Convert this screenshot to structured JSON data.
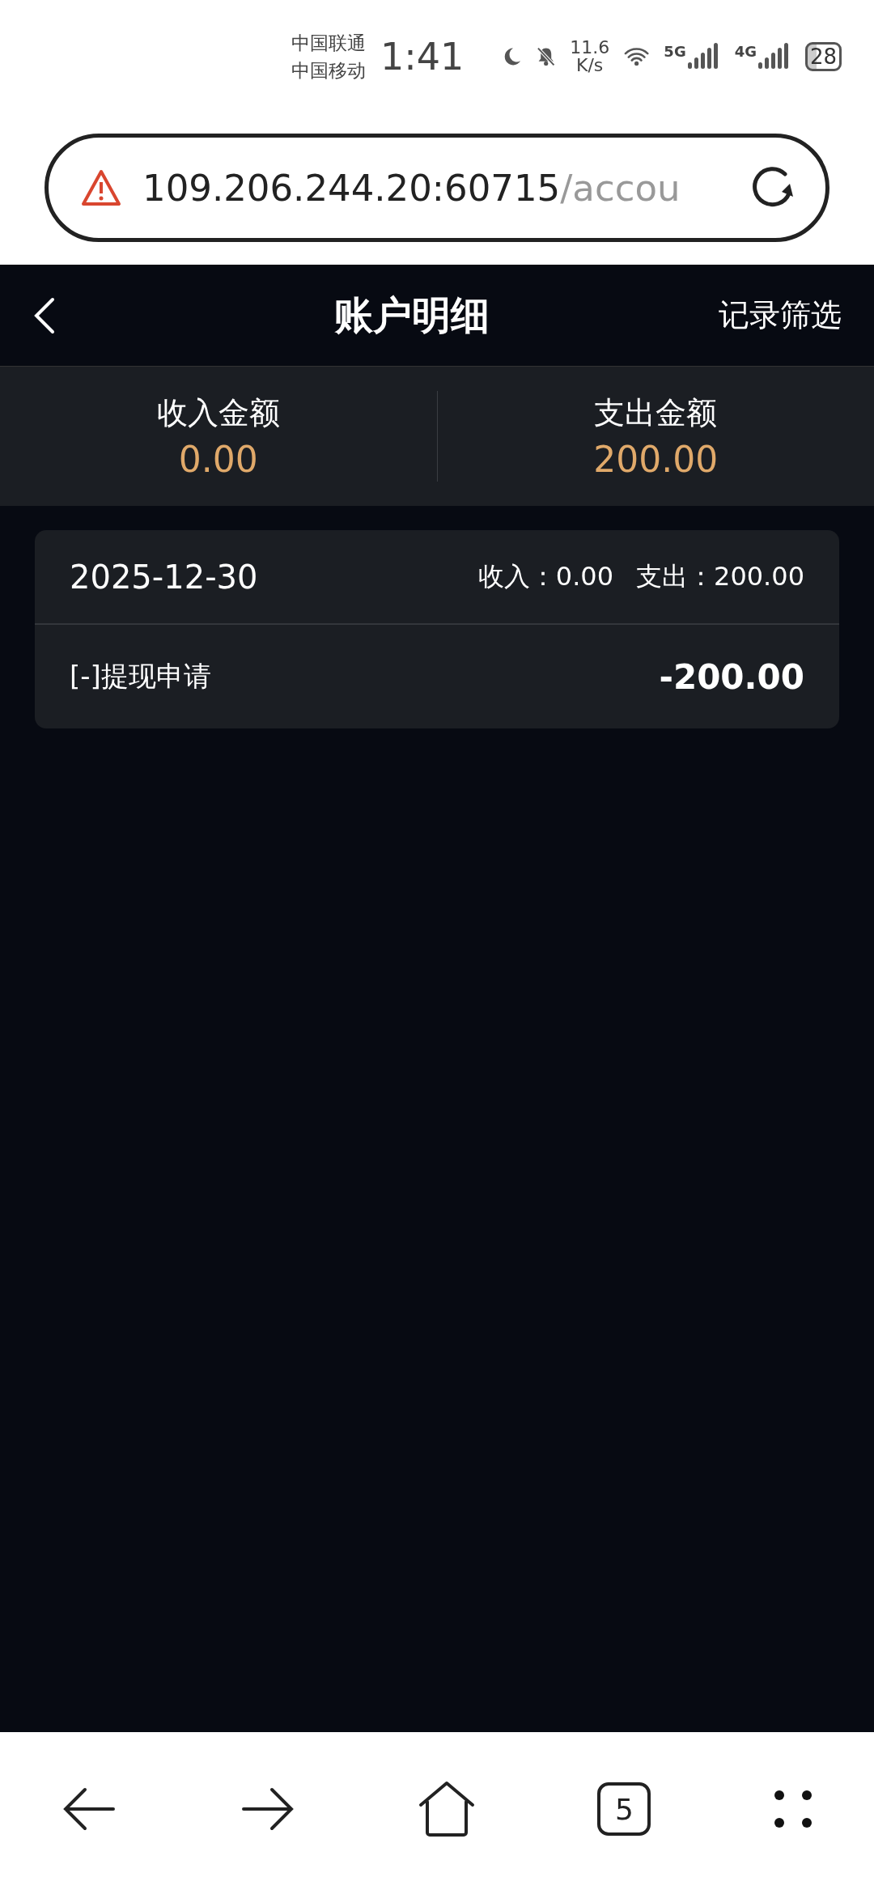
{
  "status_bar": {
    "carriers": [
      "中国联通",
      "中国移动"
    ],
    "time": "1:41",
    "speed": [
      "11.6",
      "K/s"
    ],
    "signals": [
      {
        "label": "5G"
      },
      {
        "label": "4G"
      }
    ],
    "battery": "28"
  },
  "address_bar": {
    "host": "109.206.244.20:60715",
    "path": "/accou"
  },
  "header": {
    "title": "账户明细",
    "action": "记录筛选"
  },
  "summary": [
    {
      "label": "收入金额",
      "value": "0.00"
    },
    {
      "label": "支出金额",
      "value": "200.00"
    }
  ],
  "groups": [
    {
      "date": "2025-12-30",
      "totals": [
        {
          "label": "收入：",
          "value": "0.00"
        },
        {
          "label": "支出：",
          "value": "200.00"
        }
      ],
      "entries": [
        {
          "title": "[-]提现申请",
          "amount": "-200.00"
        }
      ]
    }
  ],
  "browser_nav": {
    "tabs_count": "5"
  }
}
